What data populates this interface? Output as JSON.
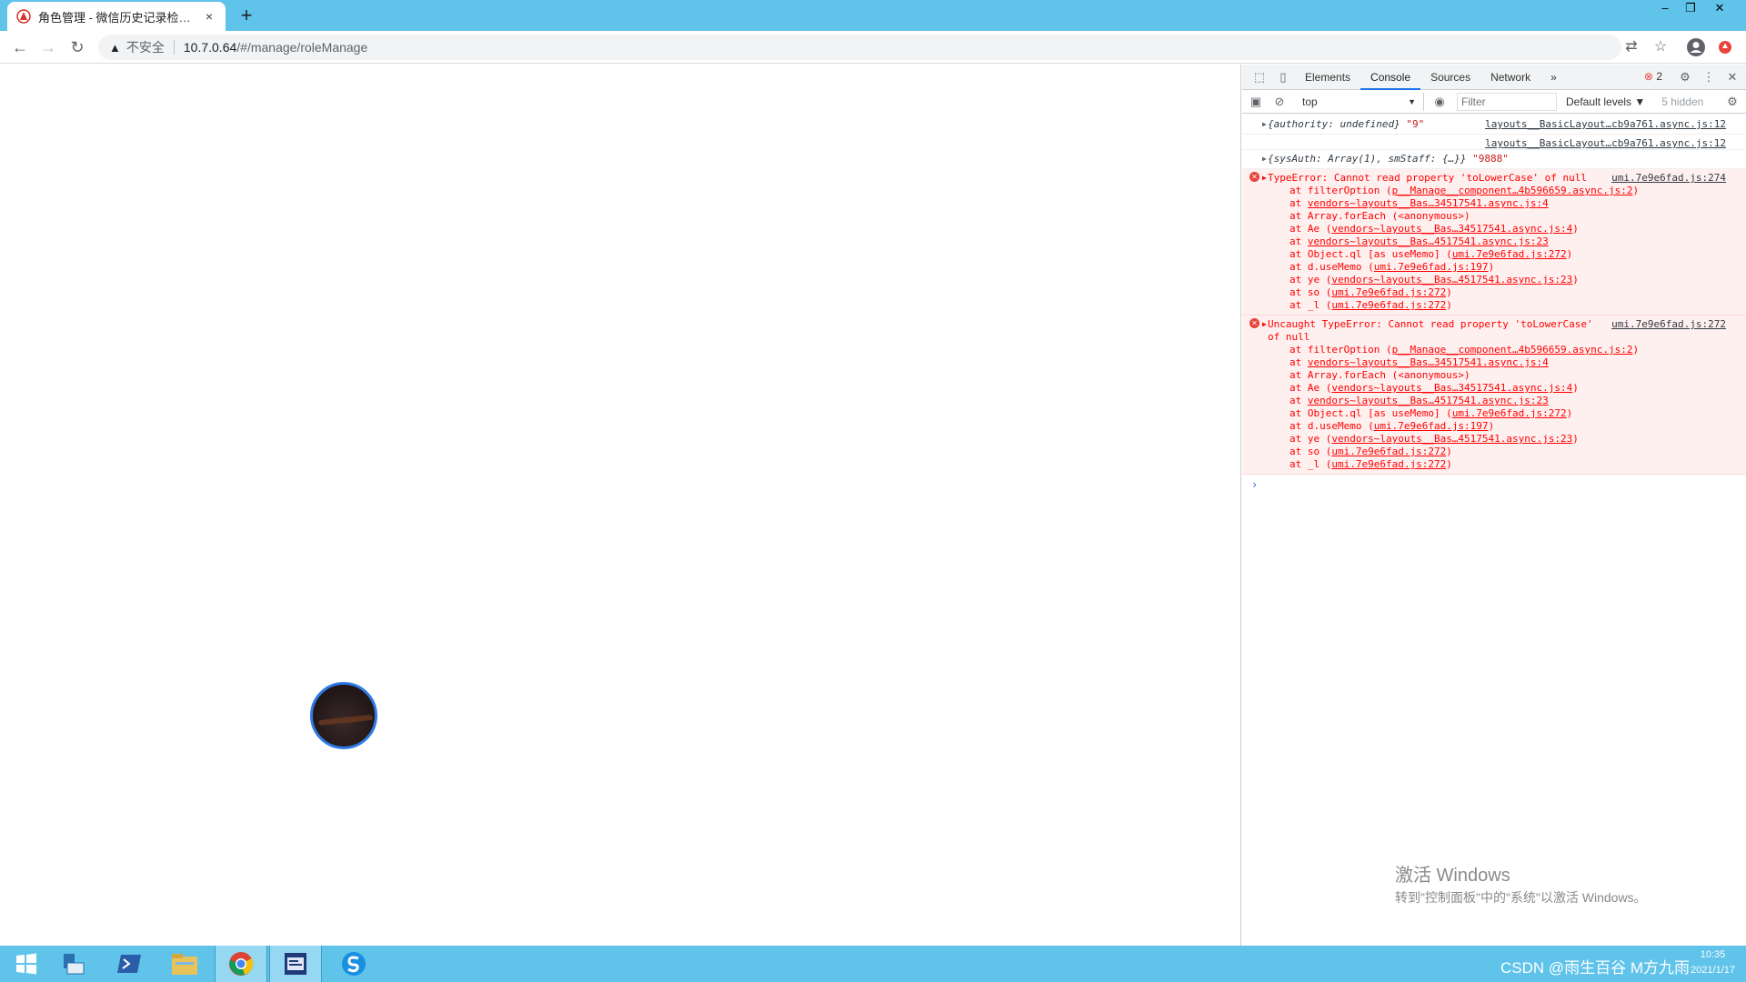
{
  "browser": {
    "tab_title": "角色管理 - 微信历史记录检索系",
    "tab_close": "×",
    "new_tab": "+",
    "insecure_label": "不安全",
    "url_host": "10.7.0.64",
    "url_path": "/#/manage/roleManage"
  },
  "window_controls": {
    "minimize": "–",
    "restore": "❐",
    "close": "✕"
  },
  "devtools": {
    "tabs": [
      "Elements",
      "Console",
      "Sources",
      "Network"
    ],
    "more_tabs": "»",
    "error_count": "2",
    "context": "top",
    "filter_placeholder": "Filter",
    "levels": "Default levels ▼",
    "hidden": "5 hidden",
    "logs": [
      {
        "text": "{authority: undefined}",
        "str": " \"9\"",
        "src": "layouts__BasicLayout…cb9a761.async.js:12"
      },
      {
        "text": "",
        "str": "",
        "src": "layouts__BasicLayout…cb9a761.async.js:12"
      },
      {
        "text": "{sysAuth: Array(1), smStaff: {…}}",
        "str": " \"9888\"",
        "src": ""
      }
    ],
    "errors": [
      {
        "message": "TypeError: Cannot read property 'toLowerCase' of null",
        "src": "umi.7e9e6fad.js:274",
        "frames": [
          {
            "fn": "at filterOption (",
            "loc": "p__Manage__component…4b596659.async.js:2",
            "end": ")"
          },
          {
            "fn": "at ",
            "loc": "vendors~layouts__Bas…34517541.async.js:4",
            "end": ""
          },
          {
            "fn": "at Array.forEach (<anonymous>)",
            "loc": "",
            "end": ""
          },
          {
            "fn": "at Ae (",
            "loc": "vendors~layouts__Bas…34517541.async.js:4",
            "end": ")"
          },
          {
            "fn": "at ",
            "loc": "vendors~layouts__Bas…4517541.async.js:23",
            "end": ""
          },
          {
            "fn": "at Object.ql [as useMemo] (",
            "loc": "umi.7e9e6fad.js:272",
            "end": ")"
          },
          {
            "fn": "at d.useMemo (",
            "loc": "umi.7e9e6fad.js:197",
            "end": ")"
          },
          {
            "fn": "at ye (",
            "loc": "vendors~layouts__Bas…4517541.async.js:23",
            "end": ")"
          },
          {
            "fn": "at so (",
            "loc": "umi.7e9e6fad.js:272",
            "end": ")"
          },
          {
            "fn": "at _l (",
            "loc": "umi.7e9e6fad.js:272",
            "end": ")"
          }
        ]
      },
      {
        "message": "Uncaught TypeError: Cannot read property 'toLowerCase' of null",
        "src": "umi.7e9e6fad.js:272",
        "frames": [
          {
            "fn": "at filterOption (",
            "loc": "p__Manage__component…4b596659.async.js:2",
            "end": ")"
          },
          {
            "fn": "at ",
            "loc": "vendors~layouts__Bas…34517541.async.js:4",
            "end": ""
          },
          {
            "fn": "at Array.forEach (<anonymous>)",
            "loc": "",
            "end": ""
          },
          {
            "fn": "at Ae (",
            "loc": "vendors~layouts__Bas…34517541.async.js:4",
            "end": ")"
          },
          {
            "fn": "at ",
            "loc": "vendors~layouts__Bas…4517541.async.js:23",
            "end": ""
          },
          {
            "fn": "at Object.ql [as useMemo] (",
            "loc": "umi.7e9e6fad.js:272",
            "end": ")"
          },
          {
            "fn": "at d.useMemo (",
            "loc": "umi.7e9e6fad.js:197",
            "end": ")"
          },
          {
            "fn": "at ye (",
            "loc": "vendors~layouts__Bas…4517541.async.js:23",
            "end": ")"
          },
          {
            "fn": "at so (",
            "loc": "umi.7e9e6fad.js:272",
            "end": ")"
          },
          {
            "fn": "at _l (",
            "loc": "umi.7e9e6fad.js:272",
            "end": ")"
          }
        ]
      }
    ],
    "prompt": "›"
  },
  "watermark": {
    "title": "激活 Windows",
    "subtitle": "转到\"控制面板\"中的\"系统\"以激活 Windows。"
  },
  "taskbar": {
    "tray_text": "CSDN @雨生百谷  M方九雨",
    "time": "10:35",
    "date": "2021/1/17"
  },
  "colors": {
    "taskbar": "#5fc3ea",
    "accent": "#1a73e8",
    "error": "#ff0000",
    "spinner_ring": "#2f7ae5"
  }
}
